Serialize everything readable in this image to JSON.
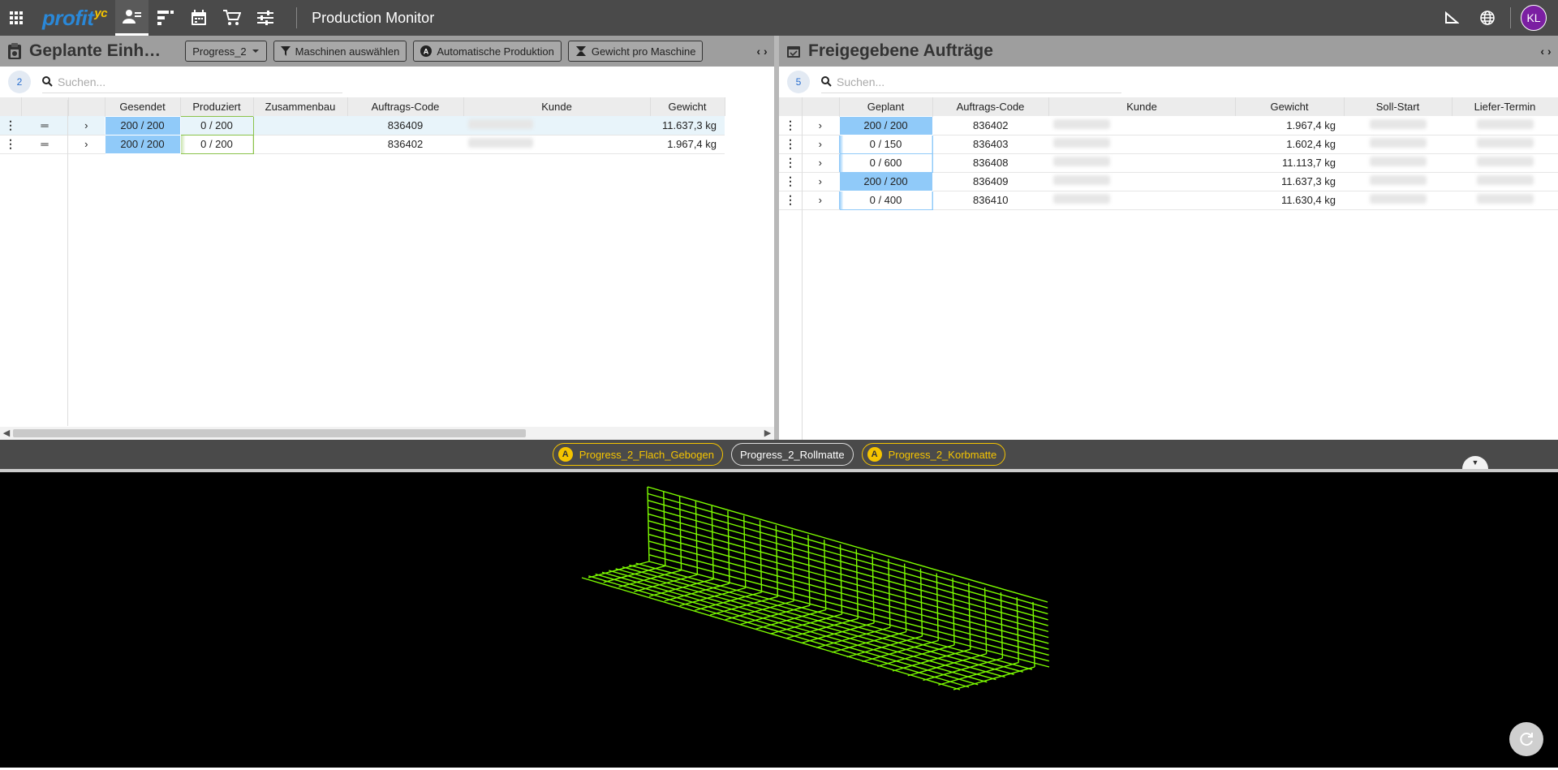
{
  "topbar": {
    "logo_text": "profit",
    "logo_suffix": "yc",
    "title": "Production Monitor",
    "avatar_initials": "KL"
  },
  "left": {
    "title": "Geplante Einh…",
    "count": "2",
    "search_placeholder": "Suchen...",
    "chips": {
      "machine_select": "Progress_2",
      "select_machines": "Maschinen auswählen",
      "auto_production": "Automatische Produktion",
      "weight_per_machine": "Gewicht pro Maschine"
    },
    "columns": [
      "Gesendet",
      "Produziert",
      "Zusammenbau",
      "Auftrags-Code",
      "Kunde",
      "Gewicht"
    ],
    "rows": [
      {
        "gesendet": "200 / 200",
        "produziert": "0 / 200",
        "code": "836409",
        "gewicht": "11.637,3 kg"
      },
      {
        "gesendet": "200 / 200",
        "produziert": "0 / 200",
        "code": "836402",
        "gewicht": "1.967,4 kg"
      }
    ]
  },
  "right": {
    "title": "Freigegebene Aufträge",
    "count": "5",
    "search_placeholder": "Suchen...",
    "columns": [
      "Geplant",
      "Auftrags-Code",
      "Kunde",
      "Gewicht",
      "Soll-Start",
      "Liefer-Termin"
    ],
    "rows": [
      {
        "geplant": "200 / 200",
        "code": "836402",
        "gewicht": "1.967,4 kg",
        "full": true
      },
      {
        "geplant": "0 / 150",
        "code": "836403",
        "gewicht": "1.602,4 kg",
        "full": false
      },
      {
        "geplant": "0 / 600",
        "code": "836408",
        "gewicht": "11.113,7 kg",
        "full": false
      },
      {
        "geplant": "200 / 200",
        "code": "836409",
        "gewicht": "11.637,3 kg",
        "full": true
      },
      {
        "geplant": "0 / 400",
        "code": "836410",
        "gewicht": "11.630,4 kg",
        "full": false
      }
    ]
  },
  "machine_tabs": [
    {
      "label": "Progress_2_Flach_Gebogen",
      "auto": true,
      "auto_mark": "A"
    },
    {
      "label": "Progress_2_Rollmatte",
      "auto": false
    },
    {
      "label": "Progress_2_Korbmatte",
      "auto": true,
      "auto_mark": "A"
    }
  ],
  "colors": {
    "topbar": "#4a4a4a",
    "accent_yellow": "#f5c400",
    "cell_blue": "#90caf9",
    "mesh_green": "#7CFC00",
    "avatar": "#7b1fa2"
  }
}
